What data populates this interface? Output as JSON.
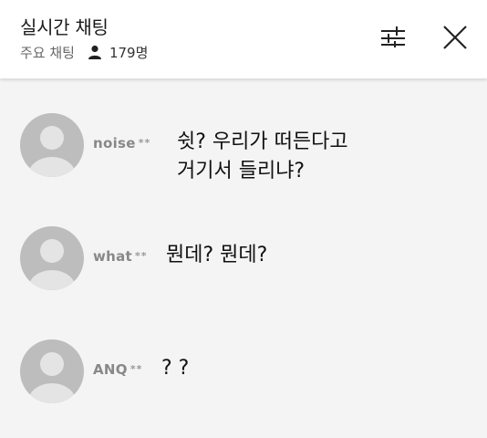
{
  "header": {
    "title": "실시간 채팅",
    "subtitle": "주요 채팅",
    "participant_count": "179명",
    "icons": [
      "person-icon",
      "settings-sliders-icon",
      "close-icon"
    ]
  },
  "messages": [
    {
      "nickname": "noise",
      "masked": "**",
      "lines": [
        "쉿? 우리가 떠든다고",
        "거기서 들리냐?"
      ]
    },
    {
      "nickname": "what",
      "masked": "**",
      "lines": [
        "뭔데? 뭔데?"
      ]
    },
    {
      "nickname": "ANQ",
      "masked": "**",
      "lines": [
        "? ?"
      ]
    }
  ],
  "colors": {
    "header_bg": "#ffffff",
    "chat_bg": "#f4f4f4",
    "nickname": "#888888",
    "avatar_bg": "#bdbdbd"
  }
}
